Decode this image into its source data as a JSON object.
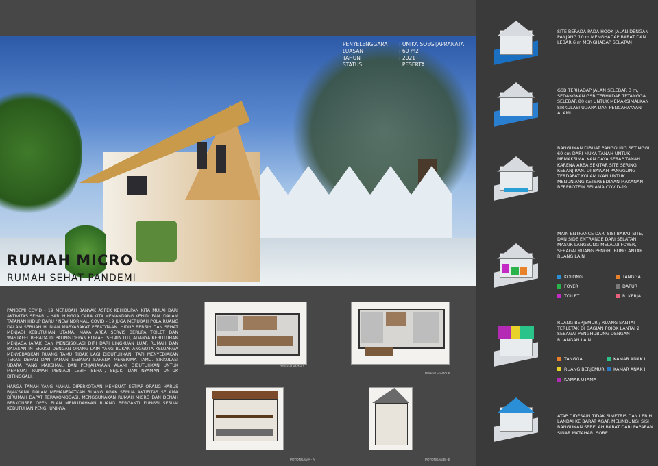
{
  "info": [
    {
      "k": "PENYELENGGARA",
      "v": ": UNIKA SOEGIJAPRANATA"
    },
    {
      "k": "LUASAN",
      "v": ": 60 m2"
    },
    {
      "k": "TAHUN",
      "v": ": 2021"
    },
    {
      "k": "STATUS",
      "v": ": PESERTA"
    }
  ],
  "title": "RUMAH MICRO",
  "subtitle": "RUMAH SEHAT PANDEMI",
  "paragraphs": [
    "PANDEMI COVID - 19 MERUBAH BANYAK ASPEK KEHIDUPAN KITA MULAI DARI AKTIVITAS SEHARI - HARI HINGGA CARA KITA MEMANDANG KEHIDUPAN. DALAM TATANAN HIDUP BARU / NEW NORMAL, COVID - 19 JUGA MERUBAH POLA RUANG DALAM SEBUAH HUNIAN MASYARAKAT PERKOTAAN. HIDUP BERSIH DAN SEHAT MENJADI KEBUTUHAN UTAMA, MAKA AREA SERVIS BERUPA TOILET DAN WASTAFEL BERADA DI PALING DEPAN RUMAH. SELAIN ITU, ADANYA KEBUTUHAN MENJAGA JARAK DAN MENGISOLASI DIRI DARI LINGKUAN LUAR RUMAH DAN BATASAN INTERAKSI DENGAN ORANG LAIN YANG BUKAN ANGGOTA KELUARGA MENYEBABKAN RUANG TAMU TIDAK LAGI DIBUTUHKAN, TAPI MENYEDIAKAN TERAS DEPAN DAN TAMAN SEBAGAI SARANA MENERIMA TAMU. SIRKULASI UDARA YANG MAKSIMAL DAN PENJAHAYAAN ALAMI DIBUTUHKAN UNTUK MEMBUAT RUMAH MENJADI LEBIH SEHAT, SEJUK, DAN NYAMAN UNTUK DITINGGALI.",
    "HARGA TANAH YANG MAHAL DIPERKOTAAN MEMBUAT SETIAP ORANG HARUS BIJAKSANA DALAM MEMANFAATKAN RUANG AGAK SEMUA AKTIFITAS SELAMA DIRUMAH DAPAT TERAKOMODASI. MENGGUNAKAN RUMAH MICRO DAN DENAH BERKONSEP OPEN PLAN MEMUDAHKAN RUANG BERGANTI FUNGSI SESUAI KEBUTUHAN PENGHUNINYA."
  ],
  "captions": {
    "plan1": "DENAH LANTAI 1",
    "plan2": "DENAH LANTAI 2",
    "sectionA": "POTONGAN A - A",
    "sectionB": "POTONGAN B - B"
  },
  "panels": [
    {
      "text": "SITE BERADA PADA HOOK JALAN DENGAN PANJANG 10 m MENGHADAP BARAT DAN LEBAR 6 m MENGHADAP SELATAN"
    },
    {
      "text": "GSB TERHADAP JALAN SELEBAR 3 m, SEDANGKAN GSB TERHADAP TETANGGA SELEBAR 80 cm UNTUK MEMAKSIMALKAN SIRKULASI UDARA DAN PENCAHAYAAN ALAMI"
    },
    {
      "text": "BANGUNAN DIBUAT PANGGUNG SETINGGI 60 cm DARI MUKA TANAH UNTUK MEMAKSIMALKAN DAYA SERAP TANAH KARENA AREA SEKITAR SITE SERING KEBANJIRAN. DI BAWAH PANGGUNG TERDAPAT KOLAM IKAN UNTUK MENUNJANG KETERSEDIAAN MAKANAN BERPROTEIN SELAMA COVID-19"
    },
    {
      "text": "MAIN ENTRANCE DARI SISI BARAT SITE, DAN SIDE ENTRANCE DARI SELATAN. MASUK LANGSUNG MELALUI FOYER, SEBAGAI RUANG PENGHUBUNG ANTAR RUANG LAIN"
    },
    {
      "text": "RUANG BERJEMUR / RUANG SANTAI TERLETAK DI BAGIAN POJOK LANTAI 2 SEBAGAI PENGHUBUNG DENGAN RUANGAN LAIN"
    },
    {
      "text": "ATAP DIDESAIN TIDAK SIMETRIS DAN LEBIH LANDAI KE BARAT AGAR MELINDUNGI SISI BANGUNAN SEBELAH BARAT DARI PAPARAN SINAR MATAHARI SORE"
    }
  ],
  "legend1": [
    {
      "label": "KOLONG",
      "color": "#2a8fd6"
    },
    {
      "label": "TANGGA",
      "color": "#e8822a"
    },
    {
      "label": "FOYER",
      "color": "#2ab34a"
    },
    {
      "label": "DAPUR",
      "color": "#7a7a7a"
    },
    {
      "label": "TOILET",
      "color": "#c42ac4"
    },
    {
      "label": "R. KERJA",
      "color": "#e8627a"
    }
  ],
  "legend2": [
    {
      "label": "TANGGA",
      "color": "#e8822a"
    },
    {
      "label": "KAMAR ANAK I",
      "color": "#2ac48a"
    },
    {
      "label": "RUANG BERJEMUR",
      "color": "#e8d22a"
    },
    {
      "label": "KAMAR ANAK II",
      "color": "#2a7ac4"
    },
    {
      "label": "KAMAR UTAMA",
      "color": "#b42ab4"
    }
  ]
}
